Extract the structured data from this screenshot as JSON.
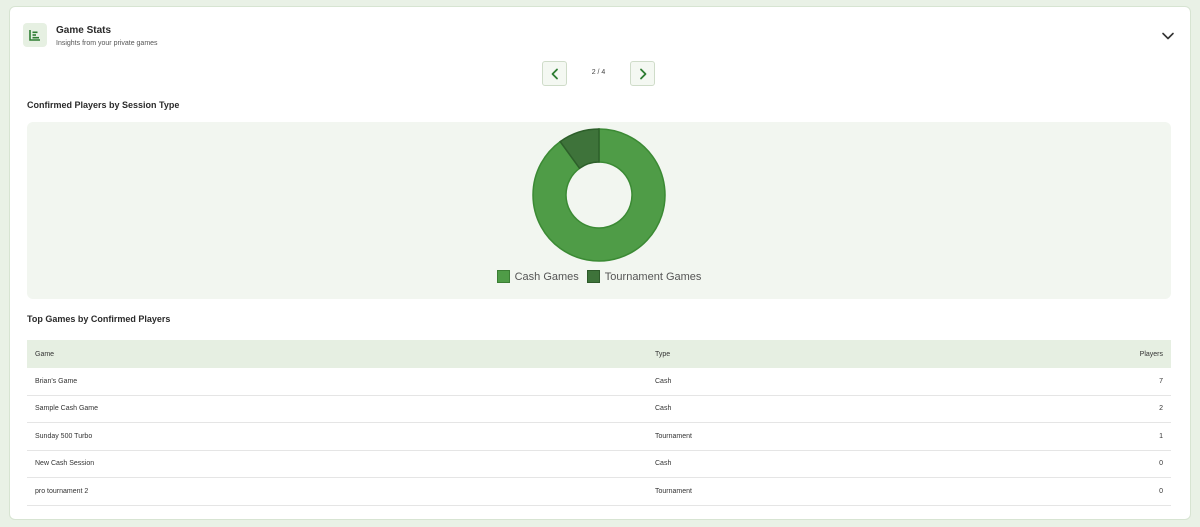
{
  "header": {
    "title": "Game Stats",
    "subtitle": "Insights from your private games",
    "icon": "bar-chart-icon"
  },
  "pager": {
    "indicator": "2 / 4"
  },
  "chart_section": {
    "title": "Confirmed Players by Session Type"
  },
  "chart_data": {
    "type": "pie",
    "style": "donut",
    "categories": [
      "Cash Games",
      "Tournament Games"
    ],
    "values": [
      9,
      1
    ],
    "colors": [
      "#4f9c47",
      "#3e733a"
    ],
    "legend_position": "bottom"
  },
  "table_section": {
    "title": "Top Games by Confirmed Players"
  },
  "table": {
    "headers": {
      "game": "Game",
      "type": "Type",
      "players": "Players"
    },
    "rows": [
      {
        "game": "Brian's Game",
        "type": "Cash",
        "players": "7"
      },
      {
        "game": "Sample Cash Game",
        "type": "Cash",
        "players": "2"
      },
      {
        "game": "Sunday 500 Turbo",
        "type": "Tournament",
        "players": "1"
      },
      {
        "game": "New Cash Session",
        "type": "Cash",
        "players": "0"
      },
      {
        "game": "pro tournament 2",
        "type": "Tournament",
        "players": "0"
      }
    ]
  },
  "colors": {
    "accent": "#4f9c47",
    "accent_dark": "#3e733a",
    "panel": "#f2f6f0"
  }
}
